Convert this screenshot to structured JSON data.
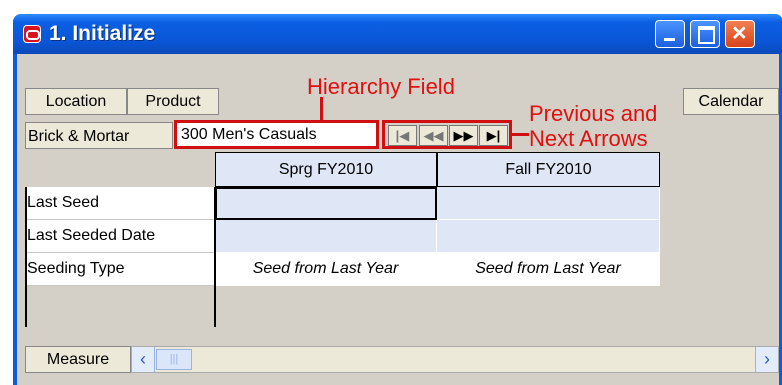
{
  "window": {
    "title": "1. Initialize"
  },
  "toolbar": {
    "location_label": "Location",
    "product_label": "Product",
    "calendar_label": "Calendar"
  },
  "filters": {
    "location_value": "Brick & Mortar",
    "product_value": "300 Men's Casuals"
  },
  "navigation": {
    "first_icon": "first-page-icon",
    "prev_icon": "previous-icon",
    "next_icon": "next-icon",
    "last_icon": "last-page-icon"
  },
  "annotations": {
    "hierarchy_field": "Hierarchy Field",
    "prev_next_line1": "Previous and",
    "prev_next_line2": "Next Arrows",
    "color": "#e01010"
  },
  "grid": {
    "columns": [
      "Sprg FY2010",
      "Fall FY2010"
    ],
    "rows": [
      {
        "label": "Last Seed",
        "values": [
          "",
          ""
        ]
      },
      {
        "label": "Last Seeded Date",
        "values": [
          "",
          ""
        ]
      },
      {
        "label": "Seeding Type",
        "values": [
          "Seed from Last Year",
          "Seed from Last Year"
        ]
      }
    ]
  },
  "footer": {
    "measure_label": "Measure"
  },
  "colors": {
    "title_bar": "#0a56d6",
    "cell_bg": "#dfe6f5",
    "annotation": "#e01010"
  }
}
